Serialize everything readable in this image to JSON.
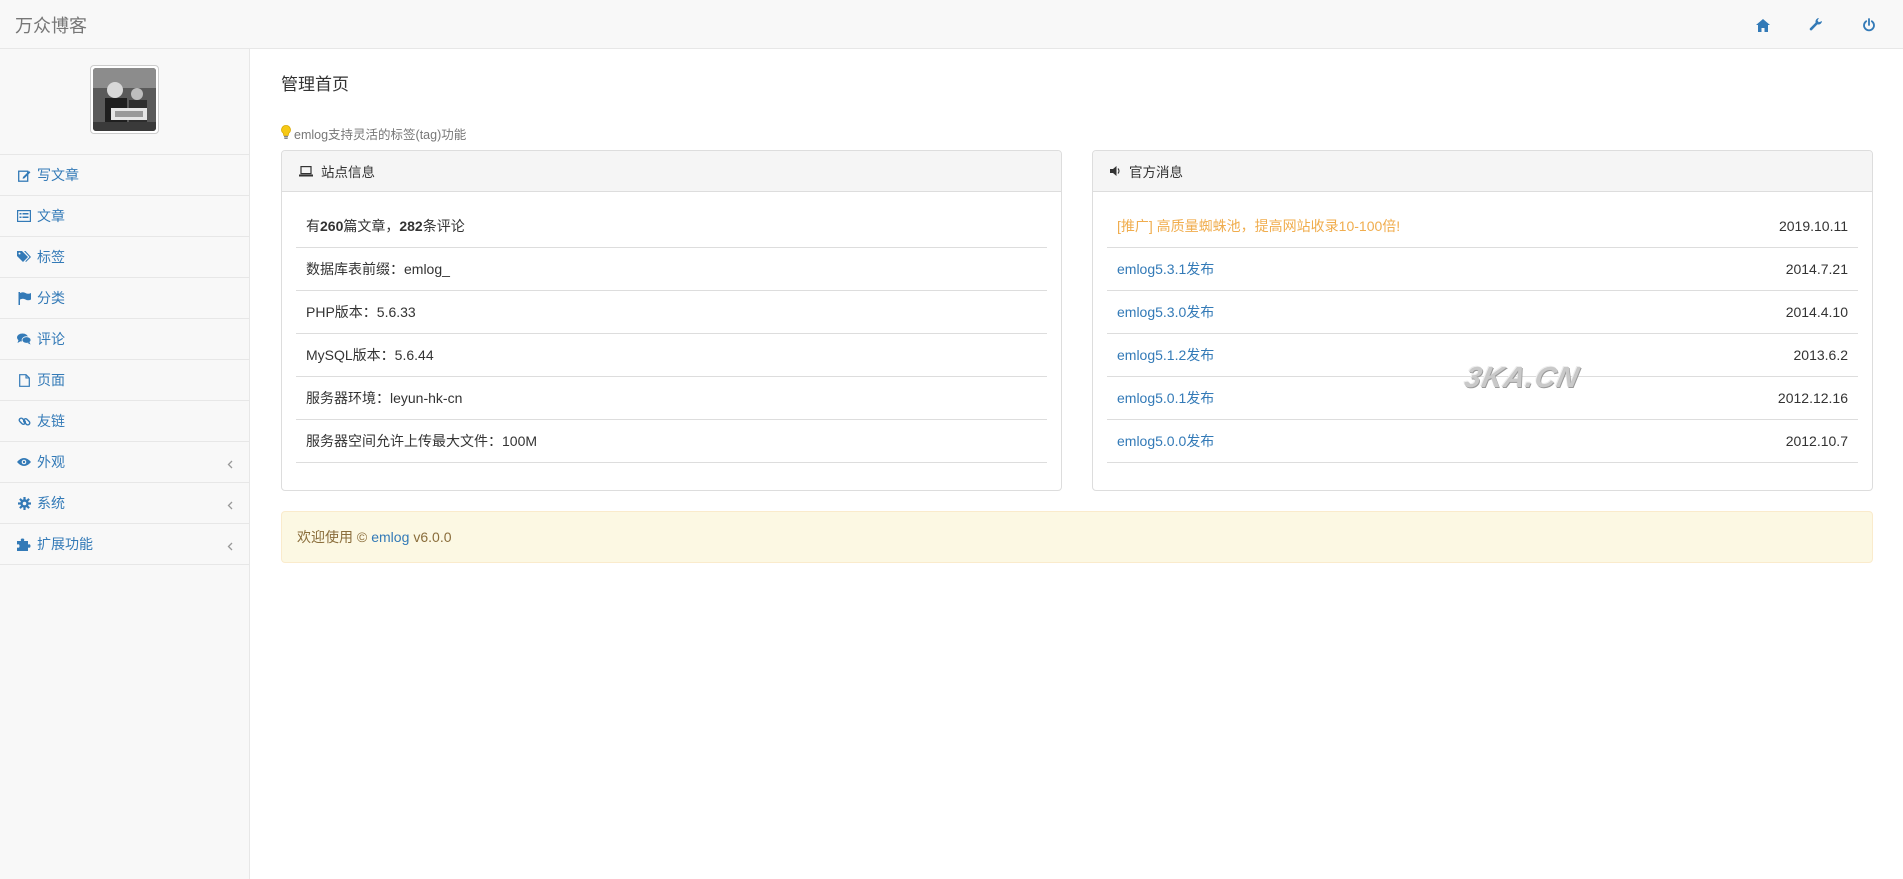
{
  "header": {
    "brand": "万众博客",
    "icons": [
      "home-icon",
      "wrench-icon",
      "power-icon"
    ]
  },
  "sidebar": {
    "items": [
      {
        "label": "写文章",
        "icon": "edit-icon"
      },
      {
        "label": "文章",
        "icon": "list-icon"
      },
      {
        "label": "标签",
        "icon": "tags-icon"
      },
      {
        "label": "分类",
        "icon": "flag-icon"
      },
      {
        "label": "评论",
        "icon": "comments-icon"
      },
      {
        "label": "页面",
        "icon": "file-icon"
      },
      {
        "label": "友链",
        "icon": "link-icon"
      },
      {
        "label": "外观",
        "icon": "eye-icon",
        "expandable": true
      },
      {
        "label": "系统",
        "icon": "gear-icon",
        "expandable": true
      },
      {
        "label": "扩展功能",
        "icon": "puzzle-icon",
        "expandable": true
      }
    ]
  },
  "main": {
    "title": "管理首页",
    "tip": "emlog支持灵活的标签(tag)功能",
    "site_info": {
      "heading": "站点信息",
      "stats": {
        "prefix": "有",
        "articles": "260",
        "mid": "篇文章，",
        "comments": "282",
        "suffix": "条评论"
      },
      "rows": [
        "数据库表前缀：emlog_",
        "PHP版本：5.6.33",
        "MySQL版本：5.6.44",
        "服务器环境：leyun-hk-cn",
        "服务器空间允许上传最大文件：100M"
      ]
    },
    "news": {
      "heading": "官方消息",
      "items": [
        {
          "title": "[推广] 高质量蜘蛛池，提高网站收录10-100倍!",
          "date": "2019.10.11",
          "promo": true
        },
        {
          "title": "emlog5.3.1发布",
          "date": "2014.7.21"
        },
        {
          "title": "emlog5.3.0发布",
          "date": "2014.4.10"
        },
        {
          "title": "emlog5.1.2发布",
          "date": "2013.6.2"
        },
        {
          "title": "emlog5.0.1发布",
          "date": "2012.12.16"
        },
        {
          "title": "emlog5.0.0发布",
          "date": "2012.10.7"
        }
      ]
    },
    "footer": {
      "prefix": "欢迎使用 ©",
      "link": "emlog",
      "version": "v6.0.0"
    }
  },
  "watermark": "3KA.CN",
  "colors": {
    "link": "#337ab7",
    "promo": "#f0ad4e",
    "footer_bg": "#fcf8e3",
    "footer_text": "#8a6d3b"
  }
}
